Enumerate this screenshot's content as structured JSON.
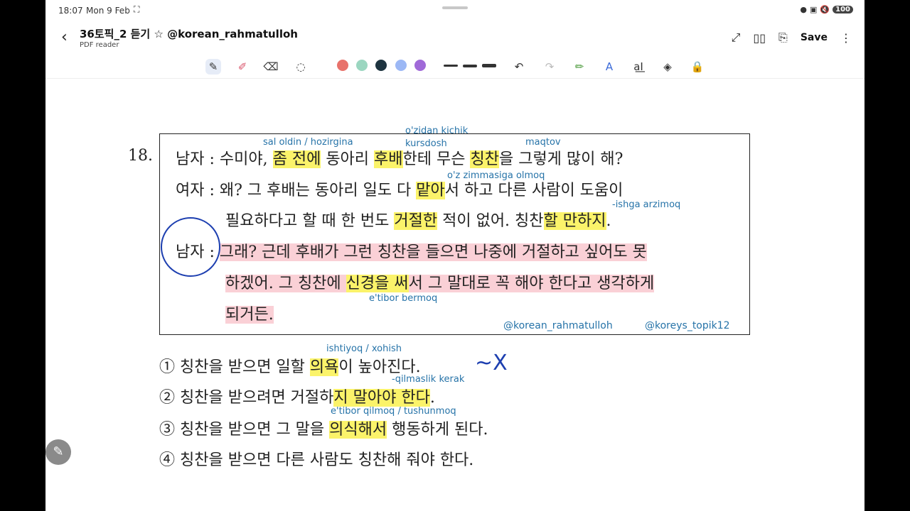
{
  "status": {
    "time": "18:07",
    "date": "Mon 9 Feb",
    "battery": "100"
  },
  "header": {
    "back": "‹",
    "title": "36토픽_2 듣기 ☆ @korean_rahmatulloh",
    "subtitle": "PDF reader",
    "save": "Save"
  },
  "toolbar": {
    "colors": [
      "#e8726b",
      "#9bd6c0",
      "#1e3440",
      "#9cb8f5",
      "#a06ad8"
    ]
  },
  "question": {
    "number": "18.",
    "lines": [
      {
        "speaker": "남자 :",
        "parts": [
          "수미야, ",
          "좀 전에",
          " 동아리 ",
          "후배",
          "한테 무슨 ",
          "칭찬",
          "을 그렇게 많이 해?"
        ]
      },
      {
        "speaker": "여자 :",
        "parts": [
          "왜? 그 후배는 동아리 일도 다 ",
          "맡아",
          "서 하고 다른 사람이 도움이"
        ]
      },
      {
        "parts": [
          "필요하다고 할 때 한 번도 ",
          "거절한",
          " 적이 없어. 칭찬",
          "할 만하지",
          "."
        ]
      },
      {
        "speaker": "남자 :",
        "parts": [
          "그래? 근데 후배가 그런 칭찬을 들으면 나중에 거절하고 싶어도 못"
        ]
      },
      {
        "parts": [
          "하겠어. 그 칭찬에 ",
          "신경을 써",
          "서 그 말대로 꼭 해야 한다고 생각하게"
        ]
      },
      {
        "parts": [
          "되거든."
        ]
      }
    ],
    "notes": {
      "n1": "sal oldin / hozirgina",
      "n2": "o'zidan kichik",
      "n3": "kursdosh",
      "n4": "maqtov",
      "n5": "o'z zimmasiga olmoq",
      "n6": "-ishga arzimoq",
      "n7": "e'tibor bermoq"
    },
    "handles": [
      "@korean_rahmatulloh",
      "@koreys_topik12"
    ]
  },
  "options": [
    {
      "num": "①",
      "parts": [
        "칭찬을 받으면 일할 ",
        "의욕",
        "이 높아진다."
      ],
      "note": "ishtiyoq / xohish"
    },
    {
      "num": "②",
      "parts": [
        "칭찬을 받으려면 거절하",
        "지 말아야 한다",
        "."
      ],
      "note": "-qilmaslik kerak"
    },
    {
      "num": "③",
      "parts": [
        "칭찬을 받으면 그 말을 ",
        "의식해서",
        " 행동하게 된다."
      ],
      "note": "e'tibor qilmoq / tushunmoq"
    },
    {
      "num": "④",
      "parts": [
        "칭찬을 받으면 다른 사람도 칭찬해 줘야 한다."
      ]
    }
  ],
  "marks": {
    "wrong": "~X"
  }
}
